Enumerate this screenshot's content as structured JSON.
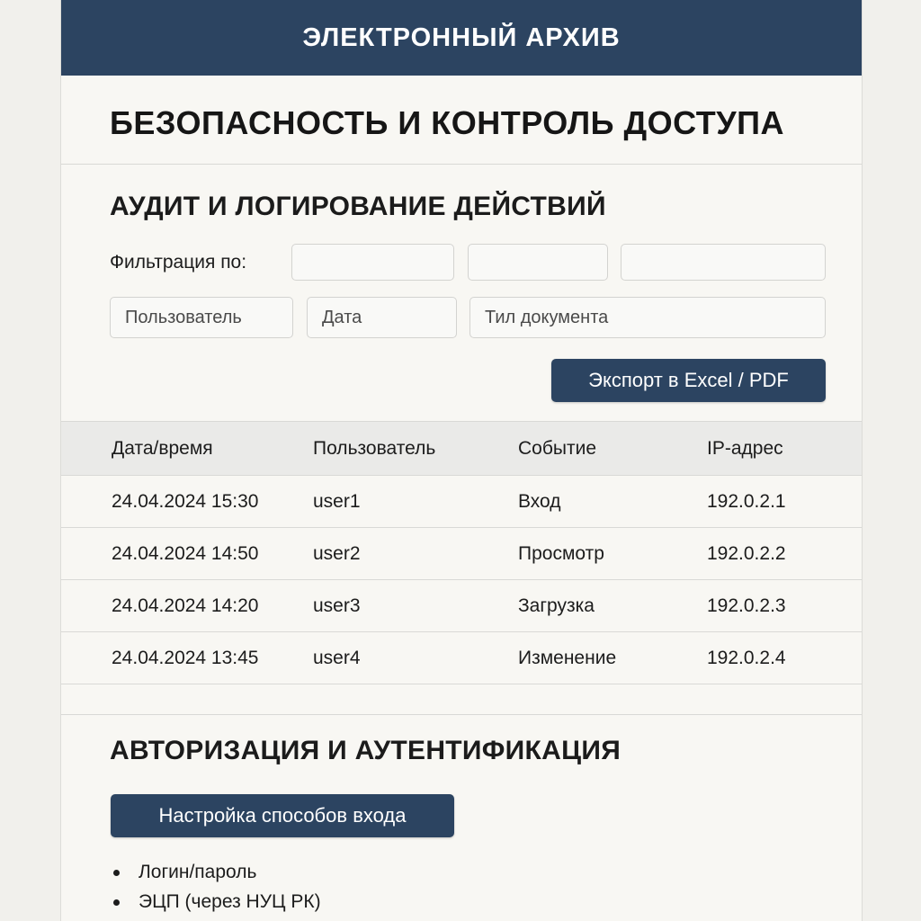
{
  "app": {
    "header_title": "ЭЛЕКТРОННЫЙ АРХИВ",
    "page_title": "БЕЗОПАСНОСТЬ И КОНТРОЛЬ ДОСТУПА"
  },
  "audit": {
    "title": "АУДИТ И ЛОГИРОВАНИЕ ДЕЙСТВИЙ",
    "filter_label": "Фильтрация по:",
    "filter_inputs": [
      {
        "value": "",
        "placeholder": ""
      },
      {
        "value": "",
        "placeholder": ""
      },
      {
        "value": "",
        "placeholder": ""
      }
    ],
    "filters": {
      "user_placeholder": "Пользователь",
      "date_placeholder": "Дата",
      "doctype_placeholder": "Тил документа"
    },
    "export_label": "Экспорт в Excel / PDF",
    "table": {
      "columns": [
        "Дата/время",
        "Пользователь",
        "Событие",
        "IP-адрес"
      ],
      "rows": [
        [
          "24.04.2024 15:30",
          "user1",
          "Вход",
          "192.0.2.1"
        ],
        [
          "24.04.2024 14:50",
          "user2",
          "Просмотр",
          "192.0.2.2"
        ],
        [
          "24.04.2024 14:20",
          "user3",
          "Загрузка",
          "192.0.2.3"
        ],
        [
          "24.04.2024 13:45",
          "user4",
          "Изменение",
          "192.0.2.4"
        ]
      ]
    }
  },
  "auth": {
    "title": "АВТОРИЗАЦИЯ И АУТЕНТИФИКАЦИЯ",
    "settings_label": "Настройка способов входа",
    "methods": [
      "Логин/пароль",
      "ЭЦП (через НУЦ РК)"
    ]
  },
  "colors": {
    "primary": "#2c4461",
    "background": "#f8f7f3",
    "table_header": "#eaeae8"
  }
}
